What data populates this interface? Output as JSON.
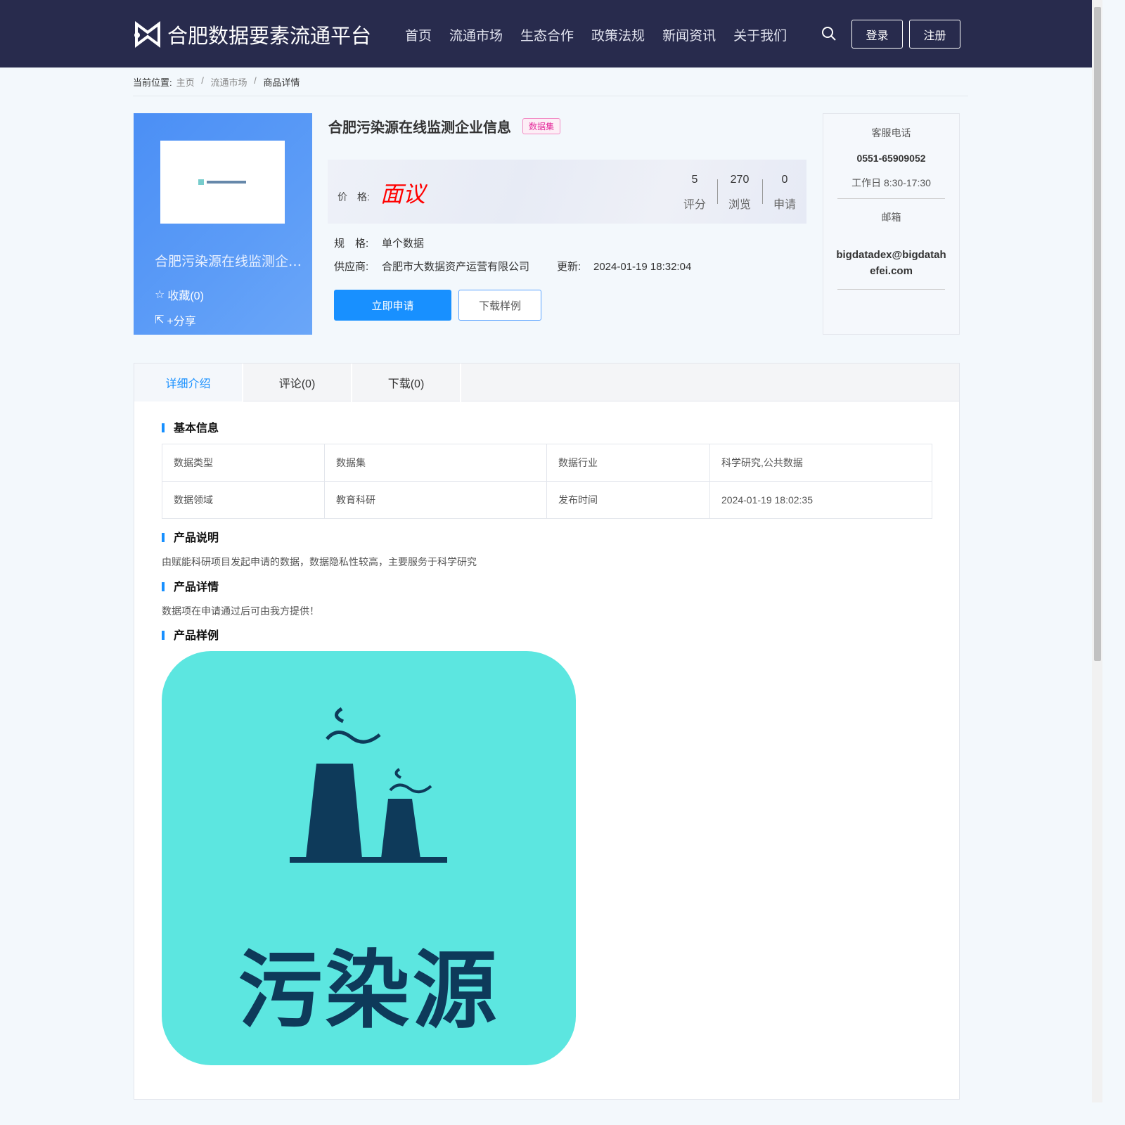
{
  "header": {
    "site_title": "合肥数据要素流通平台",
    "nav": [
      "首页",
      "流通市场",
      "生态合作",
      "政策法规",
      "新闻资讯",
      "关于我们"
    ],
    "login": "登录",
    "register": "注册"
  },
  "breadcrumb": {
    "prefix": "当前位置:",
    "items": [
      "主页",
      "流通市场",
      "商品详情"
    ]
  },
  "product": {
    "cover_name": "合肥污染源在线监测企业信息",
    "favorite": "收藏(0)",
    "share": "+分享",
    "title": "合肥污染源在线监测企业信息",
    "tag": "数据集",
    "price_label": "价　格:",
    "price": "面议",
    "stats": [
      {
        "value": "5",
        "label": "评分"
      },
      {
        "value": "270",
        "label": "浏览"
      },
      {
        "value": "0",
        "label": "申请"
      }
    ],
    "spec_label": "规　格:",
    "spec": "单个数据",
    "supplier_label": "供应商:",
    "supplier": "合肥市大数据资产运营有限公司",
    "updated_label": "更新:",
    "updated": "2024-01-19 18:32:04",
    "apply": "立即申请",
    "download_sample": "下载样例"
  },
  "service": {
    "phone_label": "客服电话",
    "phone": "0551-65909052",
    "hours": "工作日 8:30-17:30",
    "email_label": "邮箱",
    "email": "bigdatadex@bigdatahefei.com"
  },
  "tabs": [
    "详细介绍",
    "评论(0)",
    "下载(0)"
  ],
  "detail": {
    "basic_title": "基本信息",
    "table": [
      [
        "数据类型",
        "数据集",
        "数据行业",
        "科学研究,公共数据"
      ],
      [
        "数据领域",
        "教育科研",
        "发布时间",
        "2024-01-19 18:02:35"
      ]
    ],
    "desc_title": "产品说明",
    "desc": "由赋能科研项目发起申请的数据，数据隐私性较高，主要服务于科学研究",
    "detail_title": "产品详情",
    "detail_text": "数据项在申请通过后可由我方提供！",
    "sample_title": "产品样例",
    "sample_text": "污染源"
  },
  "colors": {
    "header": "#282b4d",
    "accent": "#1890ff",
    "price": "#ff0000",
    "sample_bg": "#5ce6e0",
    "sample_fg": "#0e3a5a"
  }
}
